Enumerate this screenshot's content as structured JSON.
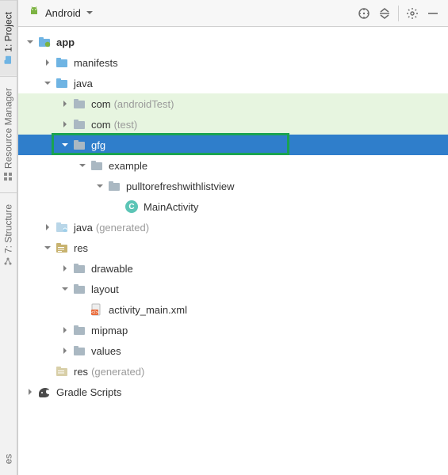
{
  "sideTabs": {
    "project": "1: Project",
    "resourceManager": "Resource Manager",
    "structure": "7: Structure",
    "favorites": "es"
  },
  "toolbar": {
    "title": "Android"
  },
  "tree": {
    "app": "app",
    "manifests": "manifests",
    "java": "java",
    "com1": "com",
    "com1_suffix": "(androidTest)",
    "com2": "com",
    "com2_suffix": "(test)",
    "gfg": "gfg",
    "example": "example",
    "pulltorefresh": "pulltorefreshwithlistview",
    "mainactivity": "MainActivity",
    "javagen": "java",
    "javagen_suffix": "(generated)",
    "res": "res",
    "drawable": "drawable",
    "layout": "layout",
    "activity_main": "activity_main.xml",
    "mipmap": "mipmap",
    "values": "values",
    "resgen": "res",
    "resgen_suffix": "(generated)",
    "gradle": "Gradle Scripts"
  }
}
